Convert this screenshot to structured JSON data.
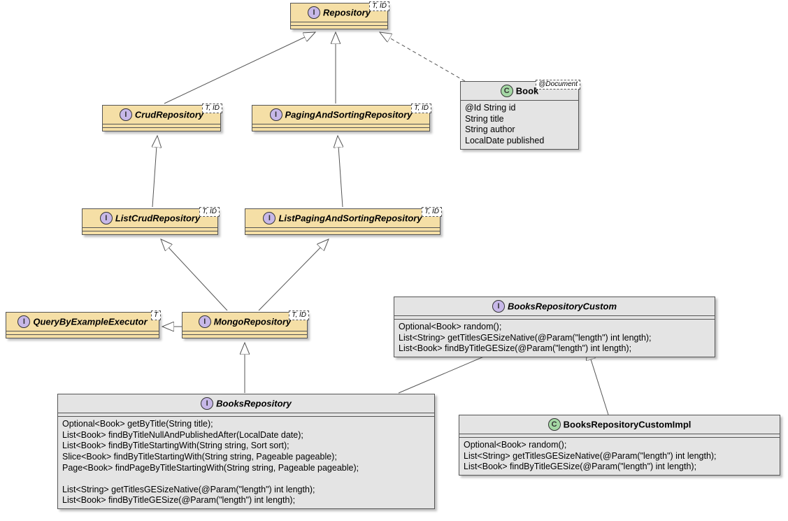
{
  "nodes": {
    "repository": {
      "kind": "I",
      "title": "Repository",
      "stereotype": "T, ID",
      "members": []
    },
    "crud": {
      "kind": "I",
      "title": "CrudRepository",
      "stereotype": "T, ID",
      "members": []
    },
    "paging": {
      "kind": "I",
      "title": "PagingAndSortingRepository",
      "stereotype": "T, ID",
      "members": []
    },
    "book": {
      "kind": "C",
      "title": "Book",
      "stereotype": "@Document",
      "members": [
        "@Id String id",
        "String title",
        "String author",
        "LocalDate published"
      ]
    },
    "listcrud": {
      "kind": "I",
      "title": "ListCrudRepository",
      "stereotype": "T, ID",
      "members": []
    },
    "listpaging": {
      "kind": "I",
      "title": "ListPagingAndSortingRepository",
      "stereotype": "T, ID",
      "members": []
    },
    "qbe": {
      "kind": "I",
      "title": "QueryByExampleExecutor",
      "stereotype": "T",
      "members": []
    },
    "mongo": {
      "kind": "I",
      "title": "MongoRepository",
      "stereotype": "T, ID",
      "members": []
    },
    "custom": {
      "kind": "I",
      "title": "BooksRepositoryCustom",
      "stereotype": null,
      "members": [
        "Optional<Book> random();",
        "List<String> getTitlesGESizeNative(@Param(\"length\") int length);",
        "List<Book> findByTitleGESize(@Param(\"length\") int length);"
      ]
    },
    "booksrepo": {
      "kind": "I",
      "title": "BooksRepository",
      "stereotype": null,
      "members": [
        "Optional<Book> getByTitle(String title);",
        "List<Book> findByTitleNullAndPublishedAfter(LocalDate date);",
        "List<Book> findByTitleStartingWith(String string, Sort sort);",
        "Slice<Book> findByTitleStartingWith(String string, Pageable pageable);",
        "Page<Book> findPageByTitleStartingWith(String string, Pageable pageable);",
        "",
        "List<String> getTitlesGESizeNative(@Param(\"length\") int length);",
        "List<Book> findByTitleGESize(@Param(\"length\") int length);"
      ]
    },
    "customimpl": {
      "kind": "C",
      "title": "BooksRepositoryCustomImpl",
      "stereotype": null,
      "members": [
        "Optional<Book> random();",
        "List<String> getTitlesGESizeNative(@Param(\"length\") int length);",
        "List<Book> findByTitleGESize(@Param(\"length\") int length);"
      ]
    }
  },
  "chart_data": {
    "type": "uml-class-diagram",
    "nodes": [
      {
        "id": "repository",
        "name": "Repository",
        "kind": "interface",
        "template": "T, ID"
      },
      {
        "id": "crud",
        "name": "CrudRepository",
        "kind": "interface",
        "template": "T, ID"
      },
      {
        "id": "paging",
        "name": "PagingAndSortingRepository",
        "kind": "interface",
        "template": "T, ID"
      },
      {
        "id": "book",
        "name": "Book",
        "kind": "class",
        "stereotype": "@Document",
        "attributes": [
          "@Id String id",
          "String title",
          "String author",
          "LocalDate published"
        ]
      },
      {
        "id": "listcrud",
        "name": "ListCrudRepository",
        "kind": "interface",
        "template": "T, ID"
      },
      {
        "id": "listpaging",
        "name": "ListPagingAndSortingRepository",
        "kind": "interface",
        "template": "T, ID"
      },
      {
        "id": "qbe",
        "name": "QueryByExampleExecutor",
        "kind": "interface",
        "template": "T"
      },
      {
        "id": "mongo",
        "name": "MongoRepository",
        "kind": "interface",
        "template": "T, ID"
      },
      {
        "id": "custom",
        "name": "BooksRepositoryCustom",
        "kind": "interface",
        "operations": [
          "Optional<Book> random();",
          "List<String> getTitlesGESizeNative(@Param(\"length\") int length);",
          "List<Book> findByTitleGESize(@Param(\"length\") int length);"
        ]
      },
      {
        "id": "booksrepo",
        "name": "BooksRepository",
        "kind": "interface",
        "operations": [
          "Optional<Book> getByTitle(String title);",
          "List<Book> findByTitleNullAndPublishedAfter(LocalDate date);",
          "List<Book> findByTitleStartingWith(String string, Sort sort);",
          "Slice<Book> findByTitleStartingWith(String string, Pageable pageable);",
          "Page<Book> findPageByTitleStartingWith(String string, Pageable pageable);",
          "",
          "List<String> getTitlesGESizeNative(@Param(\"length\") int length);",
          "List<Book> findByTitleGESize(@Param(\"length\") int length);"
        ]
      },
      {
        "id": "customimpl",
        "name": "BooksRepositoryCustomImpl",
        "kind": "class",
        "operations": [
          "Optional<Book> random();",
          "List<String> getTitlesGESizeNative(@Param(\"length\") int length);",
          "List<Book> findByTitleGESize(@Param(\"length\") int length);"
        ]
      }
    ],
    "edges": [
      {
        "from": "crud",
        "to": "repository",
        "type": "extends"
      },
      {
        "from": "paging",
        "to": "repository",
        "type": "extends"
      },
      {
        "from": "book",
        "to": "repository",
        "type": "dependency"
      },
      {
        "from": "listcrud",
        "to": "crud",
        "type": "extends"
      },
      {
        "from": "listpaging",
        "to": "paging",
        "type": "extends"
      },
      {
        "from": "mongo",
        "to": "listcrud",
        "type": "extends"
      },
      {
        "from": "mongo",
        "to": "listpaging",
        "type": "extends"
      },
      {
        "from": "mongo",
        "to": "qbe",
        "type": "extends"
      },
      {
        "from": "booksrepo",
        "to": "mongo",
        "type": "extends"
      },
      {
        "from": "booksrepo",
        "to": "custom",
        "type": "extends"
      },
      {
        "from": "customimpl",
        "to": "custom",
        "type": "implements"
      }
    ]
  }
}
